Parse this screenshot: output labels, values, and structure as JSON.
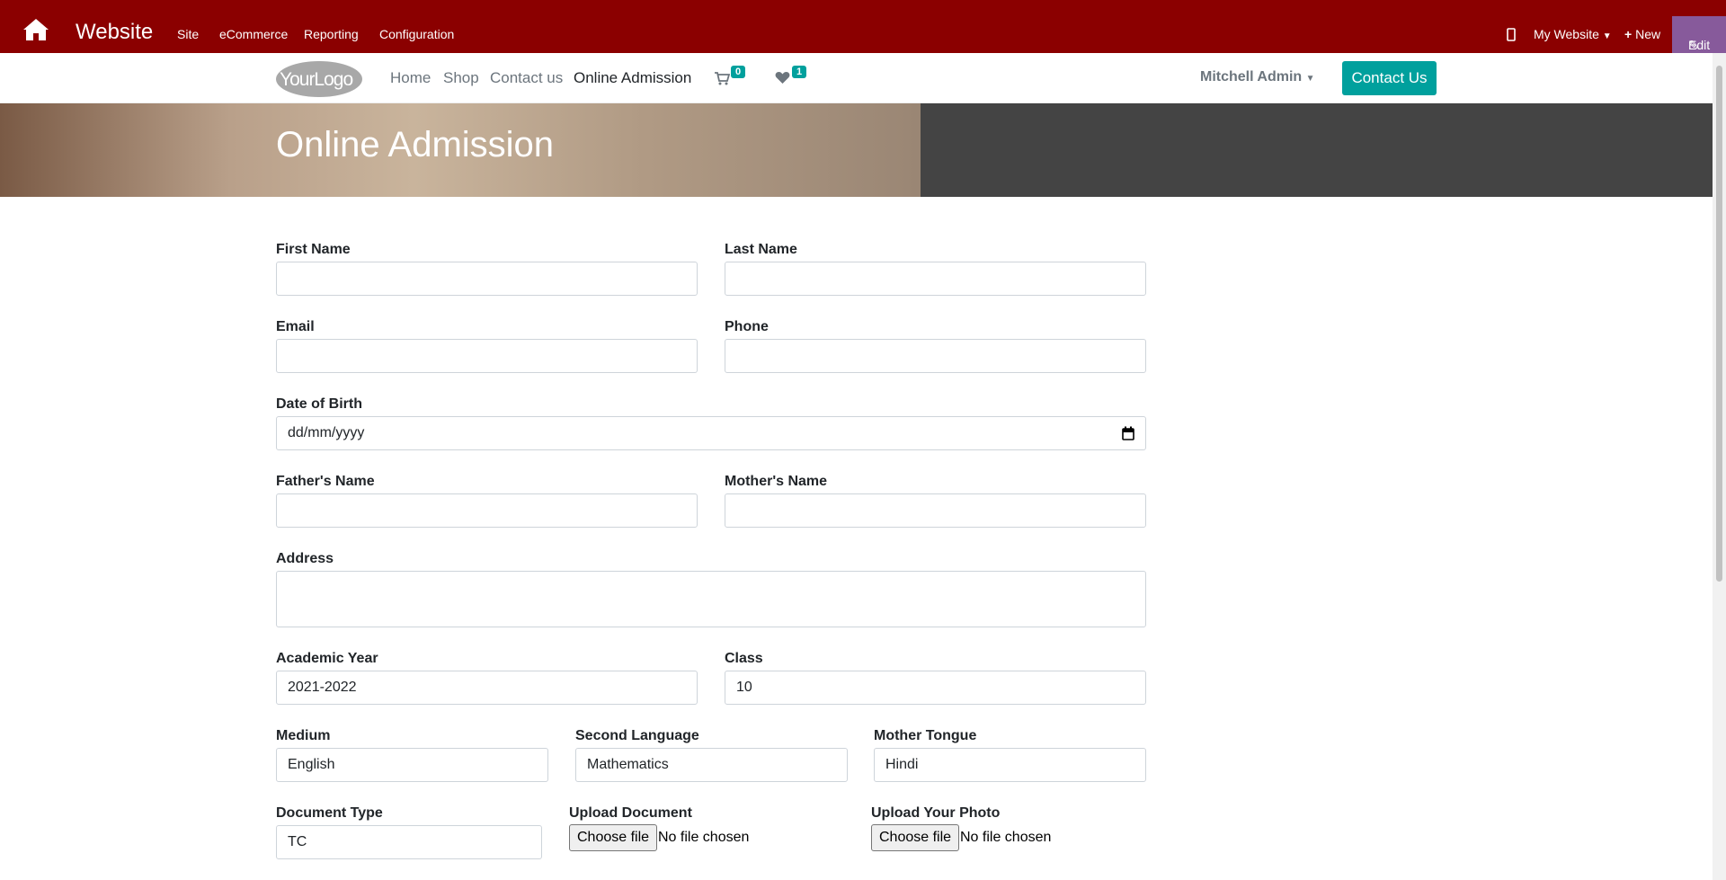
{
  "topbar": {
    "brand": "Website",
    "menu": [
      "Site",
      "eCommerce",
      "Reporting",
      "Configuration"
    ],
    "my_website": "My Website",
    "new": "New",
    "edit": "Edit"
  },
  "nav": {
    "logo": "YourLogo",
    "links": [
      "Home",
      "Shop",
      "Contact us",
      "Online Admission"
    ],
    "cart_count": "0",
    "wishlist_count": "1",
    "user": "Mitchell Admin",
    "contact_button": "Contact Us"
  },
  "hero": {
    "title": "Online Admission"
  },
  "form": {
    "first_name": {
      "label": "First Name",
      "value": ""
    },
    "last_name": {
      "label": "Last Name",
      "value": ""
    },
    "email": {
      "label": "Email",
      "value": ""
    },
    "phone": {
      "label": "Phone",
      "value": ""
    },
    "dob": {
      "label": "Date of Birth",
      "value": "dd/mm/yyyy"
    },
    "father": {
      "label": "Father's Name",
      "value": ""
    },
    "mother": {
      "label": "Mother's Name",
      "value": ""
    },
    "address": {
      "label": "Address",
      "value": ""
    },
    "academic_year": {
      "label": "Academic Year",
      "value": "2021-2022"
    },
    "class": {
      "label": "Class",
      "value": "10"
    },
    "medium": {
      "label": "Medium",
      "value": "English"
    },
    "second_language": {
      "label": "Second Language",
      "value": "Mathematics"
    },
    "mother_tongue": {
      "label": "Mother Tongue",
      "value": "Hindi"
    },
    "document_type": {
      "label": "Document Type",
      "value": "TC"
    },
    "upload_document": {
      "label": "Upload Document",
      "button": "Choose file",
      "status": "No file chosen"
    },
    "upload_photo": {
      "label": "Upload Your Photo",
      "button": "Choose file",
      "status": "No file chosen"
    }
  },
  "colors": {
    "topbar": "#8b0000",
    "accent": "#00a09d",
    "edit": "#875a9b"
  }
}
